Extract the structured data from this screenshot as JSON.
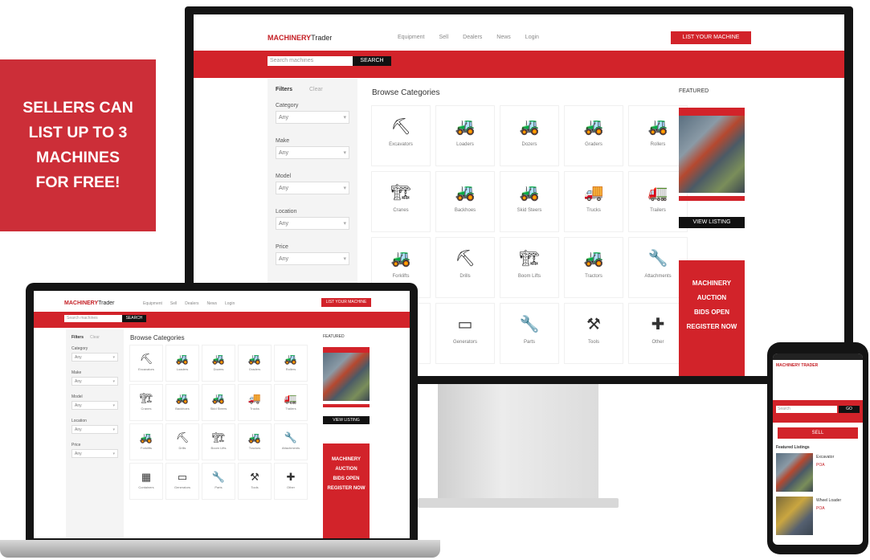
{
  "promo": {
    "lines": [
      "SELLERS CAN",
      "LIST UP TO 3",
      "MACHINES",
      "FOR FREE!"
    ]
  },
  "site": {
    "logo_main": "MACHINERY",
    "logo_sub": "Trader",
    "nav": [
      "Equipment",
      "Sell",
      "Dealers",
      "News",
      "Login"
    ],
    "cta": "LIST YOUR MACHINE",
    "search_placeholder": "Search machines",
    "search_button": "SEARCH",
    "filter_title": "Filters",
    "filter_reset": "Clear",
    "filters": [
      {
        "label": "Category",
        "value": "Any"
      },
      {
        "label": "Make",
        "value": "Any"
      },
      {
        "label": "Model",
        "value": "Any"
      },
      {
        "label": "Location",
        "value": "Any"
      },
      {
        "label": "Price",
        "value": "Any"
      }
    ],
    "heading": "Browse Categories",
    "sidebar_title": "FEATURED",
    "ad_black": "VIEW LISTING",
    "ad_red_lines": [
      "MACHINERY",
      "AUCTION",
      "BIDS OPEN",
      "REGISTER NOW"
    ],
    "categories": [
      {
        "icon": "excavator-icon",
        "glyph": "⛏",
        "label": "Excavators"
      },
      {
        "icon": "loader-icon",
        "glyph": "🚜",
        "label": "Loaders"
      },
      {
        "icon": "dozer-icon",
        "glyph": "🚜",
        "label": "Dozers"
      },
      {
        "icon": "grader-icon",
        "glyph": "🚜",
        "label": "Graders"
      },
      {
        "icon": "roller-icon",
        "glyph": "🚜",
        "label": "Rollers"
      },
      {
        "icon": "crane-icon",
        "glyph": "🏗",
        "label": "Cranes"
      },
      {
        "icon": "backhoe-icon",
        "glyph": "🚜",
        "label": "Backhoes"
      },
      {
        "icon": "skid-steer-icon",
        "glyph": "🚜",
        "label": "Skid Steers"
      },
      {
        "icon": "truck-icon",
        "glyph": "🚚",
        "label": "Trucks"
      },
      {
        "icon": "trailer-icon",
        "glyph": "🚛",
        "label": "Trailers"
      },
      {
        "icon": "forklift-icon",
        "glyph": "🚜",
        "label": "Forklifts"
      },
      {
        "icon": "drill-icon",
        "glyph": "⛏",
        "label": "Drills"
      },
      {
        "icon": "boom-lift-icon",
        "glyph": "🏗",
        "label": "Boom Lifts"
      },
      {
        "icon": "tractor-icon",
        "glyph": "🚜",
        "label": "Tractors"
      },
      {
        "icon": "attachment-icon",
        "glyph": "🔧",
        "label": "Attachments"
      }
    ],
    "categories_extra": [
      {
        "icon": "container-icon",
        "glyph": "▦",
        "label": "Containers"
      },
      {
        "icon": "generator-icon",
        "glyph": "▭",
        "label": "Generators"
      },
      {
        "icon": "parts-icon",
        "glyph": "🔧",
        "label": "Parts"
      },
      {
        "icon": "tools-icon",
        "glyph": "⚒",
        "label": "Tools"
      },
      {
        "icon": "other-icon",
        "glyph": "✚",
        "label": "Other"
      }
    ]
  },
  "phone": {
    "header": "MACHINERY TRADER",
    "search_placeholder": "Search",
    "search_button": "GO",
    "cta": "SELL",
    "section": "Featured Listings",
    "listings": [
      {
        "title": "Excavator",
        "price": "POA"
      },
      {
        "title": "Wheel Loader",
        "price": "POA"
      }
    ]
  }
}
